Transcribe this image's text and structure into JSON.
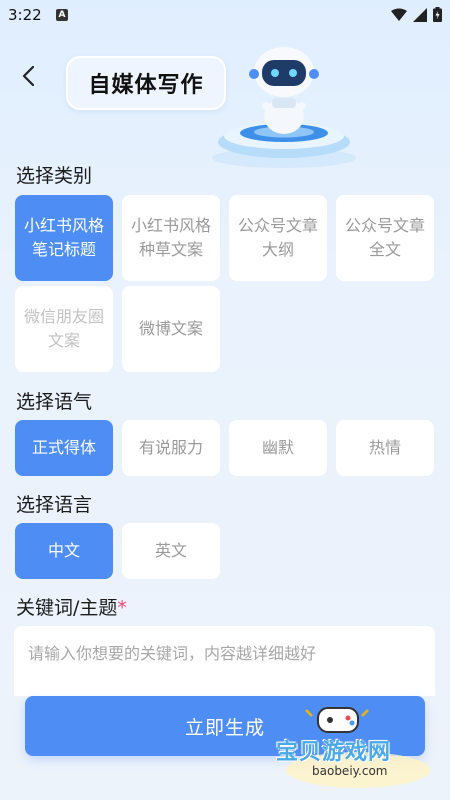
{
  "status": {
    "time": "3:22"
  },
  "header": {
    "title": "自媒体写作"
  },
  "category": {
    "label": "选择类别",
    "options": [
      "小红书风格\n笔记标题",
      "小红书风格\n种草文案",
      "公众号文章\n大纲",
      "公众号文章\n全文",
      "微信朋友圈\n文案",
      "微博文案"
    ],
    "selected_index": 0
  },
  "tone": {
    "label": "选择语气",
    "options": [
      "正式得体",
      "有说服力",
      "幽默",
      "热情"
    ],
    "selected_index": 0
  },
  "language": {
    "label": "选择语言",
    "options": [
      "中文",
      "英文"
    ],
    "selected_index": 0
  },
  "keyword": {
    "label": "关键词/主题",
    "required_mark": "*",
    "placeholder": "请输入你想要的关键词，内容越详细越好"
  },
  "actions": {
    "generate_label": "立即生成"
  },
  "watermark": {
    "text": "宝贝游戏网",
    "url": "baobeiy.com"
  },
  "colors": {
    "accent": "#4e8df3",
    "required": "#f0447b",
    "background": "#e9f2fd"
  }
}
